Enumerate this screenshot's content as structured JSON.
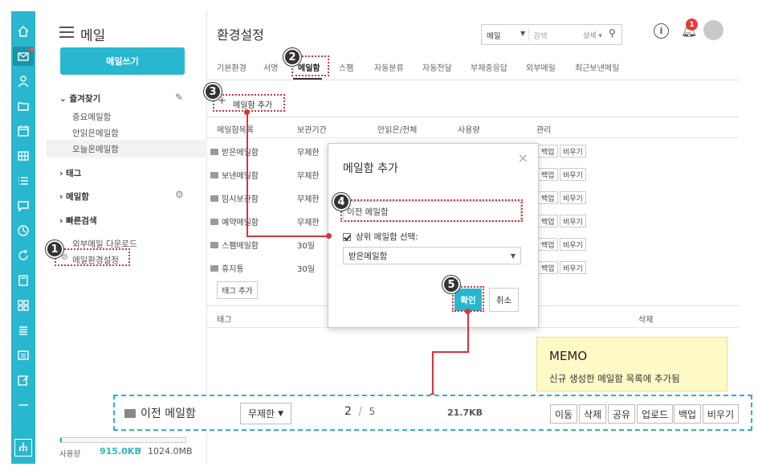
{
  "sidebar_rail": {
    "icons": [
      "home-icon",
      "mail-icon",
      "person-icon",
      "folder-icon",
      "calendar-icon",
      "grid-icon",
      "list-icon",
      "chat-icon",
      "clock-icon",
      "refresh-icon",
      "note-icon",
      "apps-icon",
      "stack-icon",
      "board-icon",
      "edit-icon",
      "minus-icon",
      "sitemap-icon"
    ]
  },
  "mail_sidebar": {
    "title": "메일",
    "write_button": "메일쓰기",
    "favorites_label": "즐겨찾기",
    "favorites": [
      "중요메일함",
      "안읽은메일함",
      "오늘온메일함"
    ],
    "tag_label": "태그",
    "mailbox_label": "메일함",
    "quick_search_label": "빠른검색",
    "external_download": "외부메일 다운로드",
    "mail_settings": "메일환경설정",
    "storage_label": "사용량",
    "storage_used": "915.0KB",
    "storage_sep": "/",
    "storage_total": "1024.0MB",
    "storage_fraction": 0.001
  },
  "header": {
    "title": "환경설정",
    "search_scope": "메일",
    "search_placeholder": "검색",
    "search_detail": "상세 ▾",
    "notification_count": "1"
  },
  "tabs": [
    "기본환경",
    "서명",
    "메일함",
    "스팸",
    "자동분류",
    "자동전달",
    "부재중응답",
    "외부메일",
    "최근보낸메일"
  ],
  "active_tab": "메일함",
  "toolbar": {
    "add_mailbox": "메일함 추가"
  },
  "table": {
    "headers": [
      "메일함목록",
      "보관기간",
      "안읽은/전체",
      "사용량",
      "관리"
    ],
    "rows": [
      {
        "name": "받은메일함",
        "period": "무제한"
      },
      {
        "name": "보낸메일함",
        "period": "무제한"
      },
      {
        "name": "임시보관함",
        "period": "무제한"
      },
      {
        "name": "예약메일함",
        "period": "무제한"
      },
      {
        "name": "스팸메일함",
        "period": "30일"
      },
      {
        "name": "휴지통",
        "period": "30일"
      }
    ],
    "row_buttons": [
      "백업",
      "비우기"
    ],
    "tag_add": "태그 추가",
    "tag_header": "태그",
    "delete_header": "삭제"
  },
  "modal": {
    "title": "메일함 추가",
    "close": "×",
    "input_value": "이전 메일함",
    "parent_checkbox_label": "상위 메일함 선택:",
    "parent_select_value": "받은메일함",
    "confirm": "확인",
    "cancel": "취소"
  },
  "annotations": [
    "1",
    "2",
    "3",
    "4",
    "5"
  ],
  "memo": {
    "title": "MEMO",
    "text": "신규 생성한 메일함 목록에 추가됨"
  },
  "result_row": {
    "name": "이전 메일함",
    "period": "무제한",
    "unread": "2",
    "sep": "/",
    "total": "5",
    "size": "21.7KB",
    "buttons": [
      "이동",
      "삭제",
      "공유",
      "업로드",
      "백업",
      "비우기"
    ]
  },
  "colors": {
    "accent": "#29b6cf",
    "annotation_red": "#d8323c",
    "memo_bg": "#fef9c6"
  }
}
